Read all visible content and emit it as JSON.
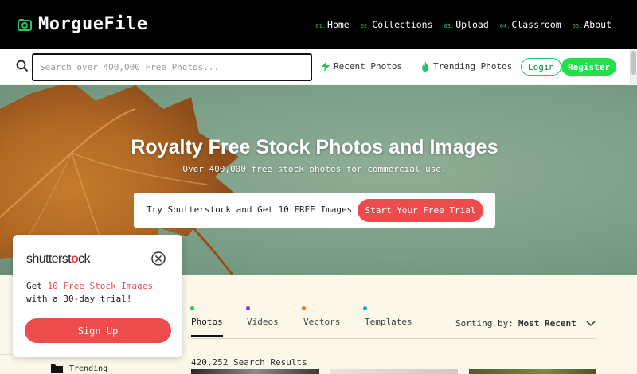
{
  "header": {
    "logo_text": "MorgueFile",
    "nav": [
      {
        "num": "01.",
        "label": "Home"
      },
      {
        "num": "02.",
        "label": "Collections"
      },
      {
        "num": "03.",
        "label": "Upload"
      },
      {
        "num": "04.",
        "label": "Classroom"
      },
      {
        "num": "05.",
        "label": "About"
      }
    ]
  },
  "search": {
    "placeholder": "Search over 400,000 Free Photos...",
    "value": ""
  },
  "quicklinks": {
    "recent": "Recent Photos",
    "trending": "Trending Photos"
  },
  "auth": {
    "login": "Login",
    "register": "Register"
  },
  "hero": {
    "title": "Royalty Free Stock Photos and Images",
    "subtitle": "Over 400,000 free stock photos for commercial use.",
    "promo_text": "Try Shutterstock and Get 10 FREE Images",
    "promo_button": "Start Your Free Trial"
  },
  "tabs": [
    {
      "label": "Photos",
      "dot_color": "#22c55e",
      "active": true
    },
    {
      "label": "Videos",
      "dot_color": "#7c3aed",
      "active": false
    },
    {
      "label": "Vectors",
      "dot_color": "#f97316",
      "active": false
    },
    {
      "label": "Templates",
      "dot_color": "#06b6d4",
      "active": false
    }
  ],
  "sorting": {
    "label": "Sorting by:",
    "value": "Most Recent"
  },
  "results": {
    "text": "420,252 Search Results"
  },
  "sidebar": {
    "item_label": "Trending"
  },
  "popup": {
    "brand_a": "shutterst",
    "brand_b": "ck",
    "text_before": "Get ",
    "text_highlight": "10 Free Stock Images",
    "text_after": " with a 30-day trial!",
    "button": "Sign Up"
  },
  "colors": {
    "accent_green": "#22c55e",
    "register_green": "#22e04a",
    "shutterstock_red": "#ec4c4c"
  }
}
